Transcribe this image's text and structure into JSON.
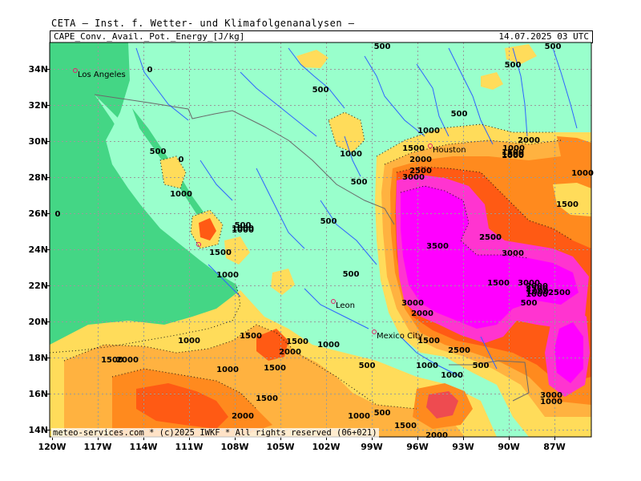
{
  "header": {
    "institute": "CETA – Inst. f. Wetter- und Klimafolgenanalysen –",
    "product": "CAPE_Conv._Avail._Pot._Energy_[J/kg]",
    "valid_time": "14.07.2025 03 UTC"
  },
  "footer": "meteo-services.com * (c)2025 IWKF * All rights reserved (06+021)",
  "colors": {
    "sea": "#44d685",
    "land_low": "#99ffcc",
    "yellow": "#ffdc5a",
    "orange_light": "#ffb240",
    "orange": "#ff8a1e",
    "orange_dark": "#ff5a14",
    "red_orange": "#ee4b50",
    "pink": "#ff34d0",
    "magenta": "#ff00ff",
    "rivers": "#2e63ff",
    "borders": "#6a6a6a"
  },
  "axes": {
    "lat_labels": [
      "34N",
      "32N",
      "30N",
      "28N",
      "26N",
      "24N",
      "22N",
      "20N",
      "18N",
      "16N",
      "14N"
    ],
    "lon_labels": [
      "120W",
      "117W",
      "114W",
      "111W",
      "108W",
      "105W",
      "102W",
      "99W",
      "96W",
      "93W",
      "90W",
      "87W"
    ]
  },
  "cities": [
    "Los Angeles",
    "Houston",
    "Leon",
    "Mexico City"
  ],
  "contour_labels": [
    "0",
    "500",
    "500",
    "500",
    "500",
    "0",
    "500",
    "1000",
    "1000",
    "0",
    "1000",
    "500",
    "1000",
    "1500",
    "2000",
    "2500",
    "3000",
    "1000",
    "1000",
    "1500",
    "2000",
    "1000",
    "1500",
    "2500",
    "500",
    "1000",
    "1500",
    "500",
    "500",
    "3500",
    "2500",
    "3000",
    "1500",
    "3000",
    "2500",
    "2000",
    "1000",
    "2500",
    "500",
    "1000",
    "3000",
    "2000",
    "1000",
    "1000",
    "1500",
    "1000",
    "1500",
    "2000",
    "1500",
    "1000",
    "2000",
    "1500",
    "2500",
    "500",
    "1000",
    "2000",
    "500",
    "1500",
    "3000",
    "1000",
    "1000",
    "500",
    "1500",
    "2000",
    "1500",
    "1500",
    "500",
    "1000"
  ]
}
